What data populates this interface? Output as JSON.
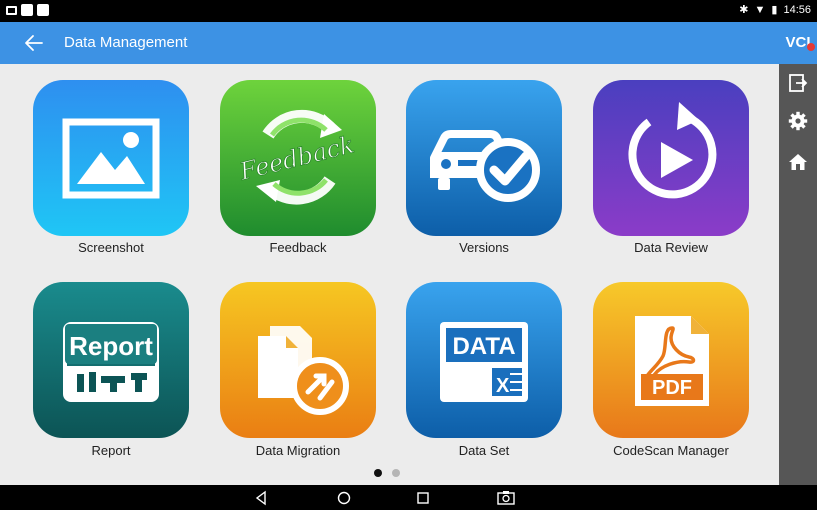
{
  "status_bar": {
    "time": "14:56"
  },
  "app_bar": {
    "title": "Data Management"
  },
  "rail": {
    "vci_label": "VCI"
  },
  "tiles": [
    {
      "label": "Screenshot",
      "icon": "image-icon"
    },
    {
      "label": "Feedback",
      "icon": "feedback-icon",
      "art_text": "Feedback"
    },
    {
      "label": "Versions",
      "icon": "car-check-icon"
    },
    {
      "label": "Data Review",
      "icon": "replay-icon"
    },
    {
      "label": "Report",
      "icon": "report-icon",
      "art_text": "Report"
    },
    {
      "label": "Data Migration",
      "icon": "migration-icon"
    },
    {
      "label": "Data Set",
      "icon": "data-sheet-icon",
      "art_text": "DATA"
    },
    {
      "label": "CodeScan Manager",
      "icon": "pdf-icon",
      "art_text": "PDF"
    }
  ],
  "pager": {
    "pages": 2,
    "current": 1
  }
}
